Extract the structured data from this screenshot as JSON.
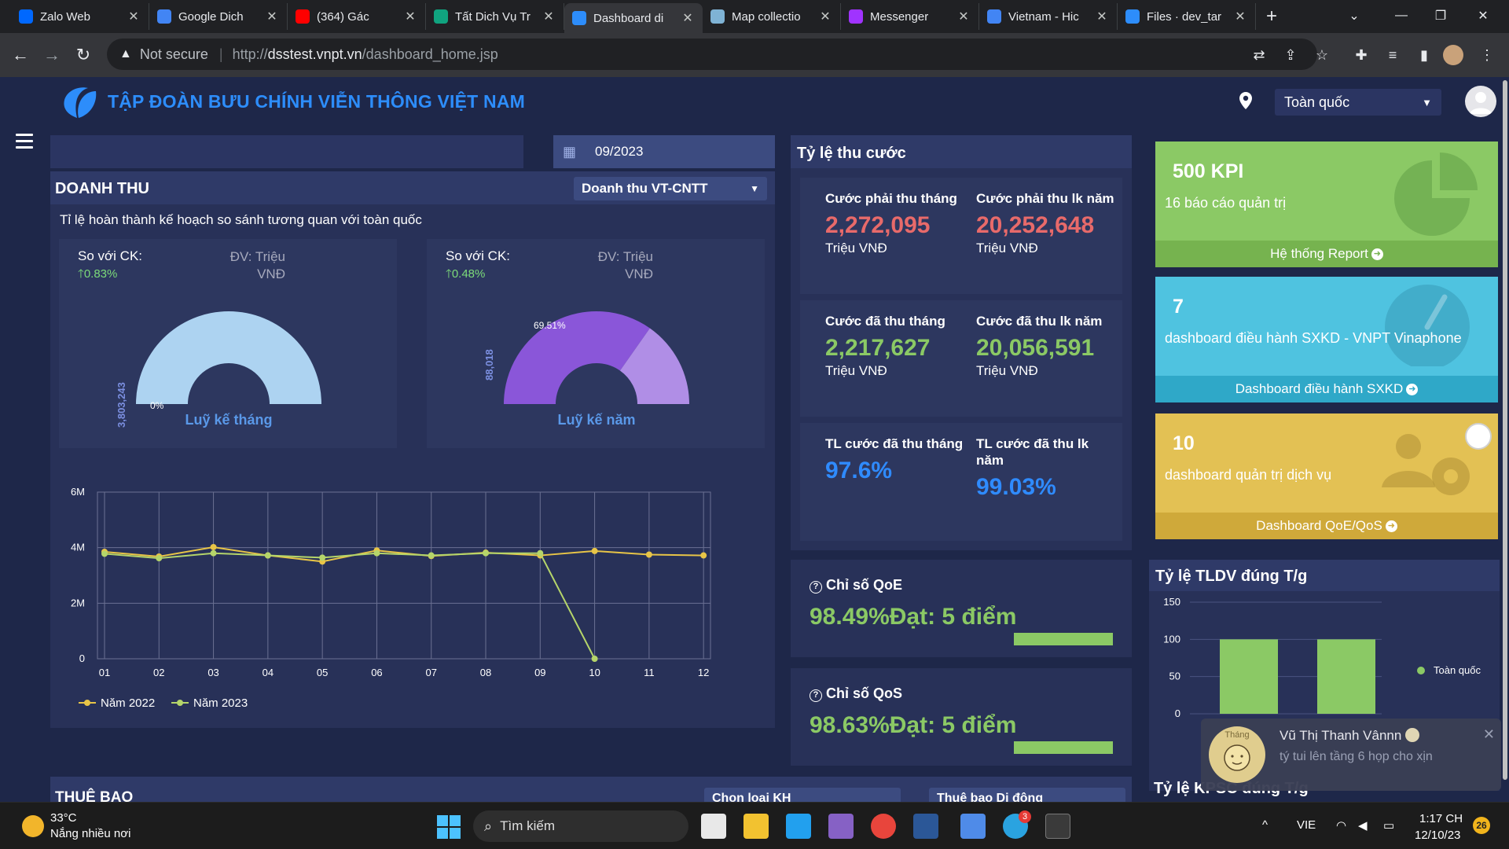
{
  "browser": {
    "tabs": [
      {
        "title": "Zalo Web",
        "icon": "zalo-icon",
        "color": "#0068ff"
      },
      {
        "title": "Google Dich",
        "icon": "google-translate-icon",
        "color": "#4285f4"
      },
      {
        "title": "(364) Gác",
        "icon": "youtube-icon",
        "color": "#ff0000"
      },
      {
        "title": "Tất Dich Vụ Tr",
        "icon": "chatgpt-icon",
        "color": "#10a37f"
      },
      {
        "title": "Dashboard di",
        "icon": "vnpt-icon",
        "color": "#2d8dfb"
      },
      {
        "title": "Map collectio",
        "icon": "map-icon",
        "color": "#7fb3d5"
      },
      {
        "title": "Messenger",
        "icon": "messenger-icon",
        "color": "#a033ff"
      },
      {
        "title": "Vietnam - Hic",
        "icon": "cloud-icon",
        "color": "#4285f4"
      },
      {
        "title": "Files · dev_tar",
        "icon": "files-icon",
        "color": "#2d8dfb"
      }
    ],
    "active_tab_index": 4,
    "not_secure_label": "Not secure",
    "url_prefix": "http://",
    "url_host": "dsstest.vnpt.vn",
    "url_path": "/dashboard_home.jsp"
  },
  "header": {
    "brand_title": "TẬP ĐOÀN BƯU CHÍNH VIỄN THÔNG VIỆT NAM",
    "region_value": "Toàn quốc"
  },
  "filters": {
    "date_value": "09/2023"
  },
  "revenue": {
    "title": "DOANH THU",
    "select_value": "Doanh thu VT-CNTT",
    "subtitle": "Tỉ lệ hoàn thành kế hoạch so sánh tương quan với toàn quốc",
    "gauges": [
      {
        "compare_label": "So với CK:",
        "compare_pct": "0.83%",
        "unit_label": "ĐV: Triệu VNĐ",
        "completion_label": "0%",
        "completion_fraction": 0.0,
        "axis_value": "3,803,243",
        "name": "Luỹ kế tháng"
      },
      {
        "compare_label": "So với CK:",
        "compare_pct": "0.48%",
        "unit_label": "ĐV: Triệu VNĐ",
        "completion_label": "69.51%",
        "completion_fraction": 0.6951,
        "axis_value": "88,018",
        "name": "Luỹ kế năm"
      }
    ],
    "colors": {
      "gauge_empty": "#add3f1",
      "gauge_fill": "#8a56d9",
      "gauge_rest": "#b08ee6",
      "line_2022": "#e8c547",
      "line_2023": "#b5d56a"
    }
  },
  "chart_data": {
    "type": "line",
    "x": [
      "01",
      "02",
      "03",
      "04",
      "05",
      "06",
      "07",
      "08",
      "09",
      "10",
      "11",
      "12"
    ],
    "ylim": [
      0,
      6000000
    ],
    "yticks": [
      0,
      2000000,
      4000000,
      6000000
    ],
    "ytick_labels": [
      "0",
      "2M",
      "4M",
      "6M"
    ],
    "series": [
      {
        "name": "Năm 2022",
        "values": [
          3850000,
          3680000,
          4020000,
          3720000,
          3500000,
          3900000,
          3700000,
          3820000,
          3720000,
          3880000,
          3750000,
          3720000
        ]
      },
      {
        "name": "Năm 2023",
        "values": [
          3780000,
          3620000,
          3800000,
          3720000,
          3640000,
          3800000,
          3720000,
          3800000,
          3800000,
          0,
          null,
          null
        ]
      }
    ],
    "grid": true,
    "legend": "bottom-left"
  },
  "collection": {
    "title": "Tỷ lệ thu cước",
    "items": [
      {
        "label": "Cước phải thu tháng",
        "value": "2,272,095",
        "unit": "Triệu VNĐ",
        "color": "#e86a6a"
      },
      {
        "label": "Cước phải thu lk năm",
        "value": "20,252,648",
        "unit": "Triệu VNĐ",
        "color": "#e86a6a"
      },
      {
        "label": "Cước đã thu tháng",
        "value": "2,217,627",
        "unit": "Triệu VNĐ",
        "color": "#8bc965"
      },
      {
        "label": "Cước đã thu lk năm",
        "value": "20,056,591",
        "unit": "Triệu VNĐ",
        "color": "#8bc965"
      },
      {
        "label": "TL cước đã thu tháng",
        "value": "97.6%",
        "unit": "",
        "color": "#2f8bff"
      },
      {
        "label": "TL cước đã thu lk năm",
        "value": "99.03%",
        "unit": "",
        "color": "#2f8bff"
      }
    ]
  },
  "qoe": {
    "title": "Chỉ số QoE",
    "value": "98.49%Đạt: 5 điểm"
  },
  "qos": {
    "title": "Chỉ số QoS",
    "value": "98.63%Đạt: 5 điểm"
  },
  "cards": [
    {
      "number": "500 KPI",
      "description": "16 báo cáo quản trị",
      "link": "Hệ thống Report",
      "color": "#8bc965",
      "footer_color": "#76b34f",
      "icon": "pie-chart-icon"
    },
    {
      "number": "7",
      "description": "dashboard điều hành SXKD - VNPT Vinaphone",
      "link": "Dashboard điều hành SXKD",
      "color": "#4fc3e0",
      "footer_color": "#2fa8c8",
      "icon": "speedometer-icon"
    },
    {
      "number": "10",
      "description": "dashboard quản trị dịch vụ",
      "link": "Dashboard QoE/QoS",
      "color": "#e3c154",
      "footer_color": "#cfa93a",
      "icon": "users-gear-icon"
    }
  ],
  "tldv": {
    "title": "Tỷ lệ TLDV đúng T/g",
    "yticks": [
      "150",
      "100",
      "50",
      "0"
    ],
    "legend": "Toàn quốc",
    "bar_values": [
      100,
      100
    ],
    "ymax": 150,
    "bar_color": "#8bc965"
  },
  "kpsc_title": "Tỷ lệ KPSC đúng T/g",
  "subscriber": {
    "title": "THUÊ BAO",
    "select_customer": "Chọn loại KH",
    "select_type": "Thuê bao Di động"
  },
  "toast": {
    "sender": "Vũ Thị Thanh Vânnn",
    "message": "tý tui lên tầng 6 họp cho xịn",
    "avatar_caption": "Tháng"
  },
  "taskbar": {
    "temperature": "33°C",
    "weather": "Nắng nhiều nơi",
    "search_placeholder": "Tìm kiếm",
    "language": "VIE",
    "time": "1:17 CH",
    "date": "12/10/23",
    "notification_count": "26",
    "telegram_badge": "3"
  }
}
